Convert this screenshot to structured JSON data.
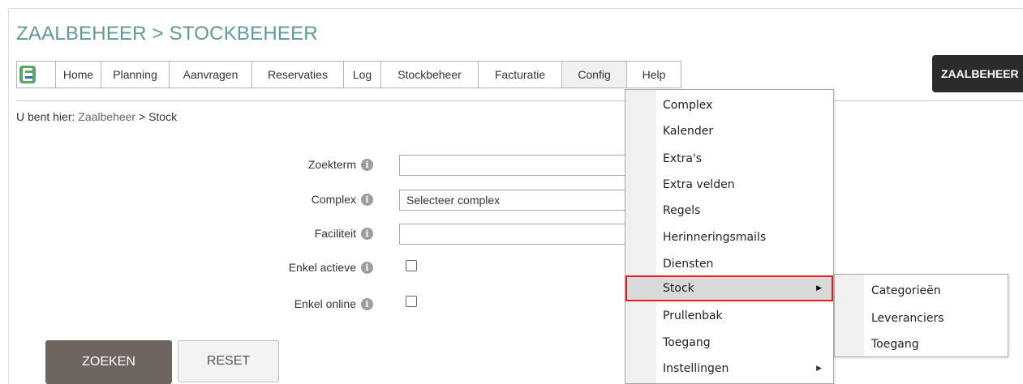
{
  "page": {
    "title": "ZAALBEHEER > STOCKBEHEER"
  },
  "nav": {
    "logo_icon": "app-logo-icon",
    "items": [
      {
        "label": "Home"
      },
      {
        "label": "Planning"
      },
      {
        "label": "Aanvragen"
      },
      {
        "label": "Reservaties"
      },
      {
        "label": "Log"
      },
      {
        "label": "Stockbeheer"
      },
      {
        "label": "Facturatie"
      },
      {
        "label": "Config"
      },
      {
        "label": "Help"
      }
    ]
  },
  "user_button": {
    "label": "ZAALBEHEER"
  },
  "breadcrumb": {
    "prefix": "U bent hier: ",
    "link": "Zaalbeheer",
    "separator": " > ",
    "current": "Stock"
  },
  "form": {
    "zoekterm_label": "Zoekterm",
    "zoekterm_value": "",
    "complex_label": "Complex",
    "complex_value": "Selecteer complex",
    "faciliteit_label": "Faciliteit",
    "faciliteit_value": "",
    "enkel_actieve_label": "Enkel actieve",
    "enkel_online_label": "Enkel online",
    "info_glyph": "i"
  },
  "buttons": {
    "zoeken": "ZOEKEN",
    "reset": "RESET"
  },
  "config_menu": {
    "items": [
      {
        "label": "Complex"
      },
      {
        "label": "Kalender"
      },
      {
        "label": "Extra's"
      },
      {
        "label": "Extra velden"
      },
      {
        "label": "Regels"
      },
      {
        "label": "Herinneringsmails"
      },
      {
        "label": "Diensten"
      },
      {
        "label": "Stock"
      },
      {
        "label": "Prullenbak"
      },
      {
        "label": "Toegang"
      },
      {
        "label": "Instellingen"
      }
    ],
    "arrow_glyph": "▶"
  },
  "stock_submenu": {
    "items": [
      {
        "label": "Categorieën"
      },
      {
        "label": "Leveranciers"
      },
      {
        "label": "Toegang"
      }
    ]
  },
  "colors": {
    "title": "#5f9b96",
    "highlight_border": "#e41e25",
    "zoeken_bg": "#6d6560",
    "user_btn_bg": "#2b2b2b"
  }
}
